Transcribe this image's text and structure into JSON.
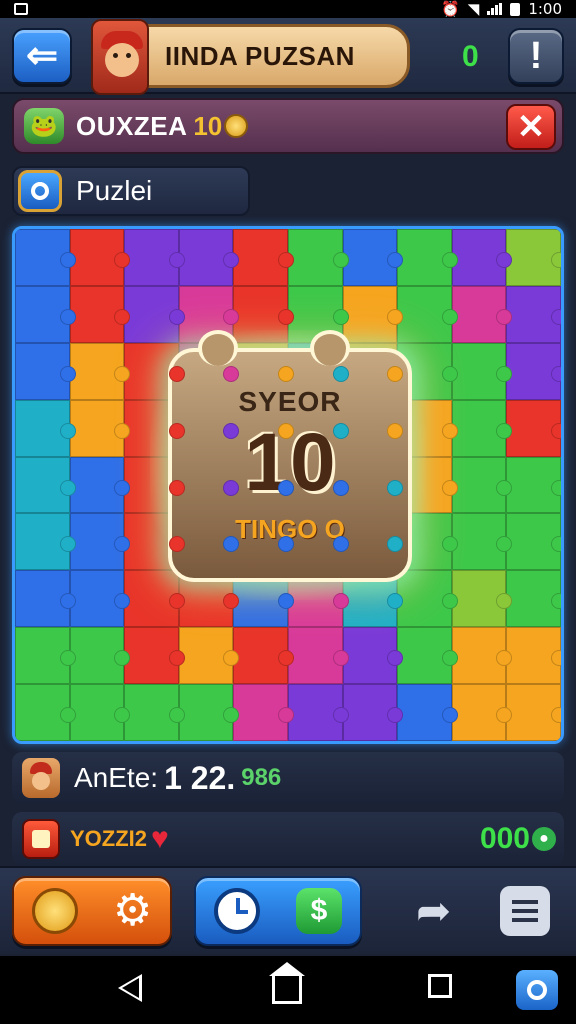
{
  "status_bar": {
    "time": "1:00"
  },
  "header": {
    "title": "IINDA PUZSAN",
    "score": "0",
    "back_icon": "arrow-left-icon",
    "alert_icon": "exclamation-icon",
    "alert_label": "!"
  },
  "quest": {
    "label": "OUXZEA",
    "value": "10",
    "close_label": "✕"
  },
  "mode_tab": {
    "label": "Puzlei"
  },
  "puzzle": {
    "piece_colors": [
      "#e8342a",
      "#2f6fe8",
      "#7a3ad8",
      "#3ec84a",
      "#f5a51f",
      "#1fb0c8",
      "#d83a9a",
      "#8ac83a"
    ],
    "card_heading": "SYEOR",
    "card_value": "10",
    "card_sub": "TINGO O"
  },
  "player_row": {
    "name": "AnEte:",
    "score": "1 22.",
    "extra": "986"
  },
  "reward_row": {
    "label": "YOZZI2",
    "score": "000",
    "heart_icon": "♥"
  },
  "toolbar": {
    "items": [
      "coin-icon",
      "gear-icon",
      "clock-icon",
      "dollar-icon",
      "share-icon",
      "menu-icon"
    ],
    "dollar_label": "$",
    "gear_label": "⚙",
    "share_label": "➦"
  }
}
